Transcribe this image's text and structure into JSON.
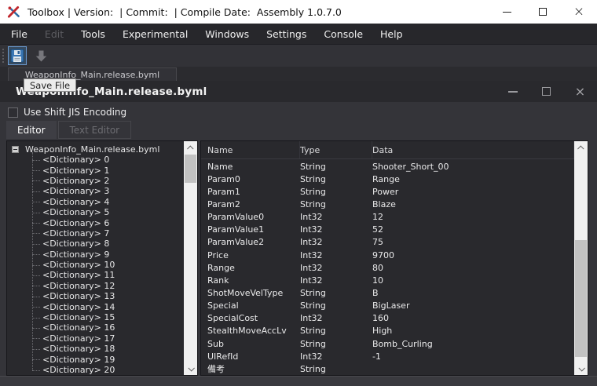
{
  "window": {
    "title": "Toolbox | Version:  | Commit:  | Compile Date:  Assembly 1.0.7.0"
  },
  "menubar": {
    "items": [
      {
        "label": "File",
        "enabled": true
      },
      {
        "label": "Edit",
        "enabled": false
      },
      {
        "label": "Tools",
        "enabled": true
      },
      {
        "label": "Experimental",
        "enabled": true
      },
      {
        "label": "Windows",
        "enabled": true
      },
      {
        "label": "Settings",
        "enabled": true
      },
      {
        "label": "Console",
        "enabled": true
      },
      {
        "label": "Help",
        "enabled": true
      }
    ]
  },
  "toolbar": {
    "save_tooltip": "Save File"
  },
  "document_tab": {
    "label": "WeaponInfo_Main.release.byml"
  },
  "inner_window": {
    "title": "WeaponInfo_Main.release.byml",
    "encoding_checkbox": {
      "label": "Use Shift JIS Encoding",
      "checked": false
    },
    "tabs": [
      {
        "label": "Editor",
        "active": true
      },
      {
        "label": "Text Editor",
        "active": false
      }
    ]
  },
  "tree": {
    "root": "WeaponInfo_Main.release.byml",
    "children": [
      "<Dictionary> 0",
      "<Dictionary> 1",
      "<Dictionary> 2",
      "<Dictionary> 3",
      "<Dictionary> 4",
      "<Dictionary> 5",
      "<Dictionary> 6",
      "<Dictionary> 7",
      "<Dictionary> 8",
      "<Dictionary> 9",
      "<Dictionary> 10",
      "<Dictionary> 11",
      "<Dictionary> 12",
      "<Dictionary> 13",
      "<Dictionary> 14",
      "<Dictionary> 15",
      "<Dictionary> 16",
      "<Dictionary> 17",
      "<Dictionary> 18",
      "<Dictionary> 19",
      "<Dictionary> 20"
    ]
  },
  "table": {
    "columns": [
      "Name",
      "Type",
      "Data"
    ],
    "rows": [
      {
        "name": "Name",
        "type": "String",
        "data": "Shooter_Short_00"
      },
      {
        "name": "Param0",
        "type": "String",
        "data": "Range"
      },
      {
        "name": "Param1",
        "type": "String",
        "data": "Power"
      },
      {
        "name": "Param2",
        "type": "String",
        "data": "Blaze"
      },
      {
        "name": "ParamValue0",
        "type": "Int32",
        "data": "12"
      },
      {
        "name": "ParamValue1",
        "type": "Int32",
        "data": "52"
      },
      {
        "name": "ParamValue2",
        "type": "Int32",
        "data": "75"
      },
      {
        "name": "Price",
        "type": "Int32",
        "data": "9700"
      },
      {
        "name": "Range",
        "type": "Int32",
        "data": "80"
      },
      {
        "name": "Rank",
        "type": "Int32",
        "data": "10"
      },
      {
        "name": "ShotMoveVelType",
        "type": "String",
        "data": "B"
      },
      {
        "name": "Special",
        "type": "String",
        "data": "BigLaser"
      },
      {
        "name": "SpecialCost",
        "type": "Int32",
        "data": "160"
      },
      {
        "name": "StealthMoveAccLv",
        "type": "String",
        "data": "High"
      },
      {
        "name": "Sub",
        "type": "String",
        "data": "Bomb_Curling"
      },
      {
        "name": "UIRefId",
        "type": "Int32",
        "data": "-1"
      },
      {
        "name": "備考",
        "type": "String",
        "data": ""
      }
    ]
  },
  "colors": {
    "save_icon_blue": "#3a76b4",
    "app_icon_red": "#c1272d",
    "app_icon_blue": "#2e6da4",
    "selection_highlight": "#6b9bd2"
  }
}
